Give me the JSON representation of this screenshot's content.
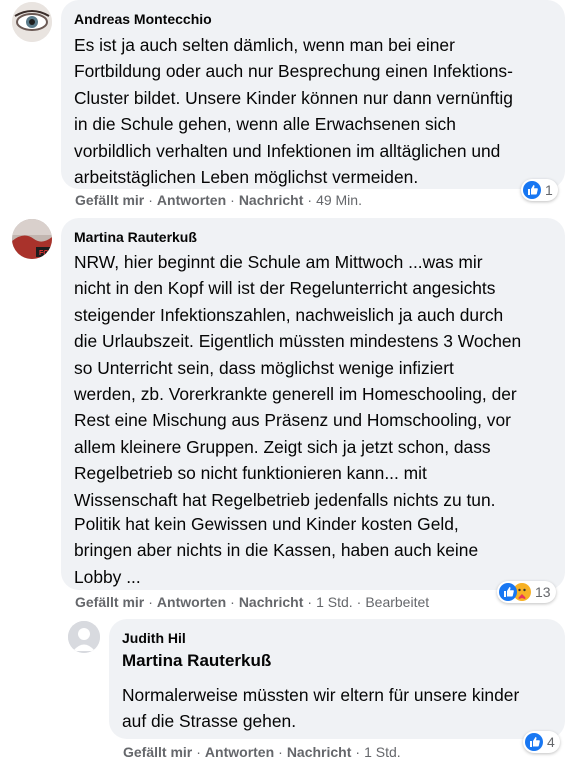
{
  "comments": [
    {
      "author": "Andreas Montecchio",
      "text": "Es ist ja auch selten dämlich, wenn man bei einer\nFortbildung oder auch nur Besprechung einen Infektions-\nCluster bildet. Unsere Kinder können nur dann vernünftig\nin die Schule gehen, wenn alle Erwachsenen sich\nvorbildlich verhalten und Infektionen im alltäglichen und\narbeitstäglichen Leben möglichst vermeiden.",
      "actions": {
        "like": "Gefällt mir",
        "reply": "Antworten",
        "message": "Nachricht",
        "time": "49 Min."
      },
      "reactions": {
        "count": "1",
        "icons": [
          "like"
        ]
      }
    },
    {
      "author": "Martina Rauterkuß",
      "text": "NRW, hier beginnt die Schule am Mittwoch ...was mir\nnicht in den Kopf will ist der Regelunterricht angesichts\nsteigender Infektionszahlen, nachweislich ja auch durch\ndie Urlaubszeit. Eigentlich müssten mindestens 3 Wochen\nso Unterricht sein, dass möglichst wenige infiziert\nwerden, zb. Vorerkrankte generell im Homeschooling, der\nRest eine Mischung aus Präsenz und Homschooling, vor\nallem kleinere Gruppen. Zeigt sich ja jetzt schon, dass\nRegelbetrieb so nicht funktionieren kann... mit\nWissenschaft hat Regelbetrieb jedenfalls nichts zu tun.",
      "text2": "Politik hat kein Gewissen und Kinder kosten Geld,\nbringen aber nichts in die Kassen, haben auch keine\nLobby ...",
      "actions": {
        "like": "Gefällt mir",
        "reply": "Antworten",
        "message": "Nachricht",
        "time": "1 Std.",
        "edited": "Bearbeitet"
      },
      "reactions": {
        "count": "13",
        "icons": [
          "like",
          "care"
        ]
      }
    },
    {
      "author": "Judith Hil",
      "mention": "Martina Rauterkuß",
      "text": "Normalerweise müssten wir eltern für unsere kinder\nauf die Strasse gehen.",
      "actions": {
        "like": "Gefällt mir",
        "reply": "Antworten",
        "message": "Nachricht",
        "time": "1 Std."
      },
      "reactions": {
        "count": "4",
        "icons": [
          "like"
        ]
      }
    }
  ]
}
